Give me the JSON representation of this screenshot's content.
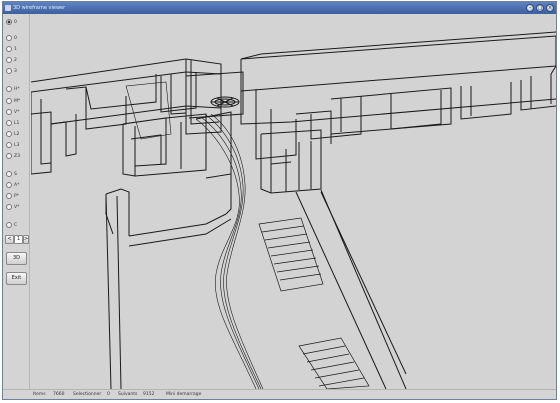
{
  "window": {
    "title": "3D wireframe viewer",
    "controls": [
      "–",
      "□",
      "×"
    ]
  },
  "sidebar": {
    "radios": [
      {
        "label": "0",
        "selected": true
      },
      {
        "label": "0",
        "selected": false
      },
      {
        "label": "1",
        "selected": false
      },
      {
        "label": "2",
        "selected": false
      },
      {
        "label": "3",
        "selected": false
      },
      {
        "label": "H*",
        "selected": false
      },
      {
        "label": "M*",
        "selected": false
      },
      {
        "label": "V*",
        "selected": false
      },
      {
        "label": "L1",
        "selected": false
      },
      {
        "label": "L2",
        "selected": false
      },
      {
        "label": "L3",
        "selected": false
      },
      {
        "label": "Z3",
        "selected": false
      },
      {
        "label": "S",
        "selected": false
      },
      {
        "label": "A*",
        "selected": false
      },
      {
        "label": "P*",
        "selected": false
      },
      {
        "label": "V*",
        "selected": false
      },
      {
        "label": "C",
        "selected": false
      }
    ],
    "prev_label": "<",
    "page_label": "1",
    "next_label": ">",
    "btn_3d": "3D",
    "btn_exit": "Exit"
  },
  "statusbar": {
    "items": [
      "Items",
      "7660",
      "Selectionner",
      "0",
      "Suivants",
      "9152",
      "Mini demarrage"
    ]
  }
}
